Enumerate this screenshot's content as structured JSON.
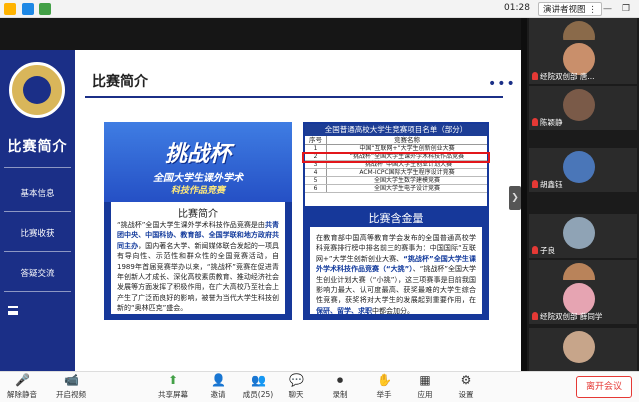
{
  "topbar": {
    "time": "01:28",
    "view_label": "演讲者视图",
    "view_caret": "⋮"
  },
  "window_controls": {
    "minimize": "—",
    "restore": "❐"
  },
  "sidebar": {
    "title": "比赛简介",
    "items": [
      {
        "label": "基本信息"
      },
      {
        "label": "比赛收获"
      },
      {
        "label": "答疑交流"
      }
    ]
  },
  "content": {
    "title": "比赛简介",
    "more": "•••"
  },
  "left_card": {
    "banner_title": "挑战杯",
    "banner_sub1": "全国大学生课外学术",
    "banner_sub2": "科技作品竞赛",
    "section_title": "比赛简介",
    "text_parts": {
      "p1": "“挑战杯”全国大学生课外学术科技作品竞赛是由",
      "h1": "共青团中央、中国科协、教育部、全国学联和地方政府共同主办",
      "p2": "，国内著名大学、新闻媒体联合发起的一项具有导向性、示范性和群众性的全国竞赛活动，自1989年首届竞赛举办以来，“挑战杯”竞赛在促进青年创新人才成长、深化高校素质教育、推动经济社会发展等方面发挥了积极作用，在广大高校乃至社会上产生了广泛而良好的影响，被誉为当代大学生科技创新的“奥林匹克”盛会。"
    }
  },
  "right_card": {
    "table_title": "全国普通高校大学生竞赛项目名单（部分）",
    "col_no": "序号",
    "col_name": "竞赛名称",
    "rows": [
      {
        "no": "1",
        "name": "中国“互联网+”大学生创新创业大赛"
      },
      {
        "no": "2",
        "name": "“挑战杯”全国大学生课外学术科技作品竞赛"
      },
      {
        "no": "3",
        "name": "“挑战杯”中国大学生创业计划大赛"
      },
      {
        "no": "4",
        "name": "ACM-ICPC国际大学生程序设计竞赛"
      },
      {
        "no": "5",
        "name": "全国大学生数学建模竞赛"
      },
      {
        "no": "6",
        "name": "全国大学生电子设计竞赛"
      }
    ],
    "section_title": "比赛含金量",
    "text_parts": {
      "p1": "在教育部中国高等教育学会发布的全国普通高校学科竞赛排行榜中排名前三的赛事为：中国国际“互联网+”大学生创新创业大赛、",
      "h1": "“挑战杯”全国大学生课外学术科技作品竞赛（“大挑”）",
      "p2": "、“挑战杯”全国大学生创业计划大赛（“小挑”），这三项赛事是目前我国影响力最大、认可度最高、获奖最难的大学生综合性竞赛，获奖将对大学生的发展起到重要作用，在",
      "h2": "保研、留学、求职",
      "p3": "中都会加分。"
    }
  },
  "gallery": {
    "participants": [
      {
        "name": "",
        "muted": false,
        "color": "#8a6a4a"
      },
      {
        "name": "经院双创部 唐...",
        "muted": true,
        "color": "#c98f6b"
      },
      {
        "name": "陈颖静",
        "muted": true,
        "color": "#7a5a48"
      },
      {
        "name": "胡鑫钰",
        "muted": true,
        "color": "#4a76b8"
      },
      {
        "name": "子良",
        "muted": true,
        "color": "#8fa3b5"
      },
      {
        "name": "",
        "muted": true,
        "color": "#b9835a"
      },
      {
        "name": "经院双创部 薛同学",
        "muted": true,
        "color": "#e6a4b2"
      },
      {
        "name": "",
        "muted": false,
        "color": "#c7a58a"
      }
    ]
  },
  "toolbar": {
    "mute": "解除静音",
    "video": "开启视频",
    "share": "共享屏幕",
    "invite": "邀请",
    "members": "成员(25)",
    "chat": "聊天",
    "record": "录制",
    "raise": "举手",
    "apps": "应用",
    "settings": "设置",
    "leave": "离开会议"
  }
}
